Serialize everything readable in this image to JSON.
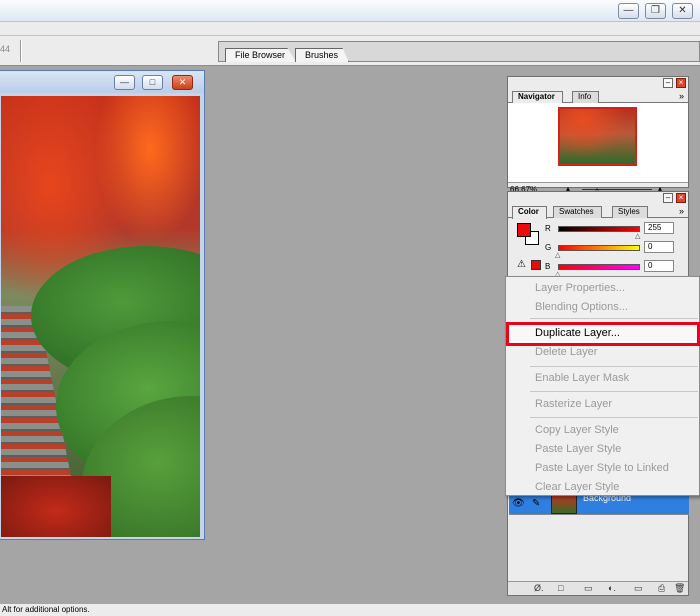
{
  "window_controls": {
    "minimize": "—",
    "restore": "❐",
    "close": "✕"
  },
  "options_bar": {
    "fragment": "44"
  },
  "palette_well": {
    "tabs": [
      "File Browser",
      "Brushes"
    ]
  },
  "document": {
    "controls": {
      "minimize": "—",
      "maximize": "□",
      "close": "✕"
    }
  },
  "navigator": {
    "tabs": [
      "Navigator",
      "Info"
    ],
    "zoom": "66.67%",
    "menu": "»"
  },
  "color": {
    "tabs": [
      "Color",
      "Swatches",
      "Styles"
    ],
    "menu": "»",
    "channels": [
      {
        "label": "R",
        "value": "255"
      },
      {
        "label": "G",
        "value": "0"
      },
      {
        "label": "B",
        "value": "0"
      }
    ],
    "foreground": "#e80c0c",
    "background": "#ffffff",
    "warning": "⚠"
  },
  "layers": {
    "row_name": "Background",
    "footer_icons": [
      "Ø.",
      "□",
      "▭",
      "◐.",
      "▭",
      "⎙",
      "🗑"
    ]
  },
  "context_menu": {
    "items": [
      {
        "label": "Layer Properties...",
        "enabled": false
      },
      {
        "label": "Blending Options...",
        "enabled": false
      },
      {
        "label": "Duplicate Layer...",
        "enabled": true,
        "highlighted": true
      },
      {
        "label": "Delete Layer",
        "enabled": false
      },
      {
        "label": "Enable Layer Mask",
        "enabled": false
      },
      {
        "label": "Rasterize Layer",
        "enabled": false
      },
      {
        "label": "Copy Layer Style",
        "enabled": false
      },
      {
        "label": "Paste Layer Style",
        "enabled": false
      },
      {
        "label": "Paste Layer Style to Linked",
        "enabled": false
      },
      {
        "label": "Clear Layer Style",
        "enabled": false
      }
    ]
  },
  "status": {
    "text": "Alt for additional options."
  },
  "colors": {
    "highlight": "#e8051a",
    "layer_selected": "#2f7fe0"
  }
}
